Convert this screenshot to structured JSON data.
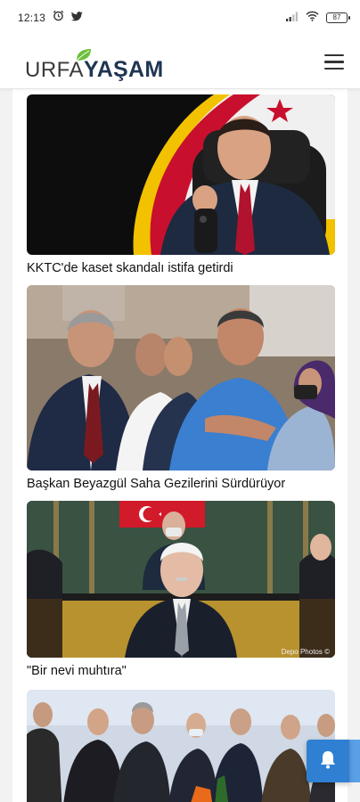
{
  "status_bar": {
    "time": "12:13",
    "battery": "87",
    "icons": [
      "alarm-icon",
      "twitter-icon",
      "signal-icon",
      "wifi-icon",
      "battery-icon"
    ]
  },
  "header": {
    "logo_part1": "URFA",
    "logo_part2": "YAŞAM",
    "menu_icon": "hamburger-menu-icon"
  },
  "colors": {
    "brand_dark": "#1f3552",
    "brand_leaf": "#6cbf3c",
    "fab_blue": "#2f80d3"
  },
  "articles": [
    {
      "title": "KKTC'de kaset skandalı istifa getirdi",
      "photo_credit": ""
    },
    {
      "title": "Başkan Beyazgül Saha Gezilerini Sürdürüyor",
      "photo_credit": ""
    },
    {
      "title": "\"Bir nevi muhtıra\"",
      "photo_credit": "Depo Photos ©"
    },
    {
      "title": "",
      "photo_credit": ""
    }
  ],
  "fab": {
    "icon": "bell-icon"
  }
}
